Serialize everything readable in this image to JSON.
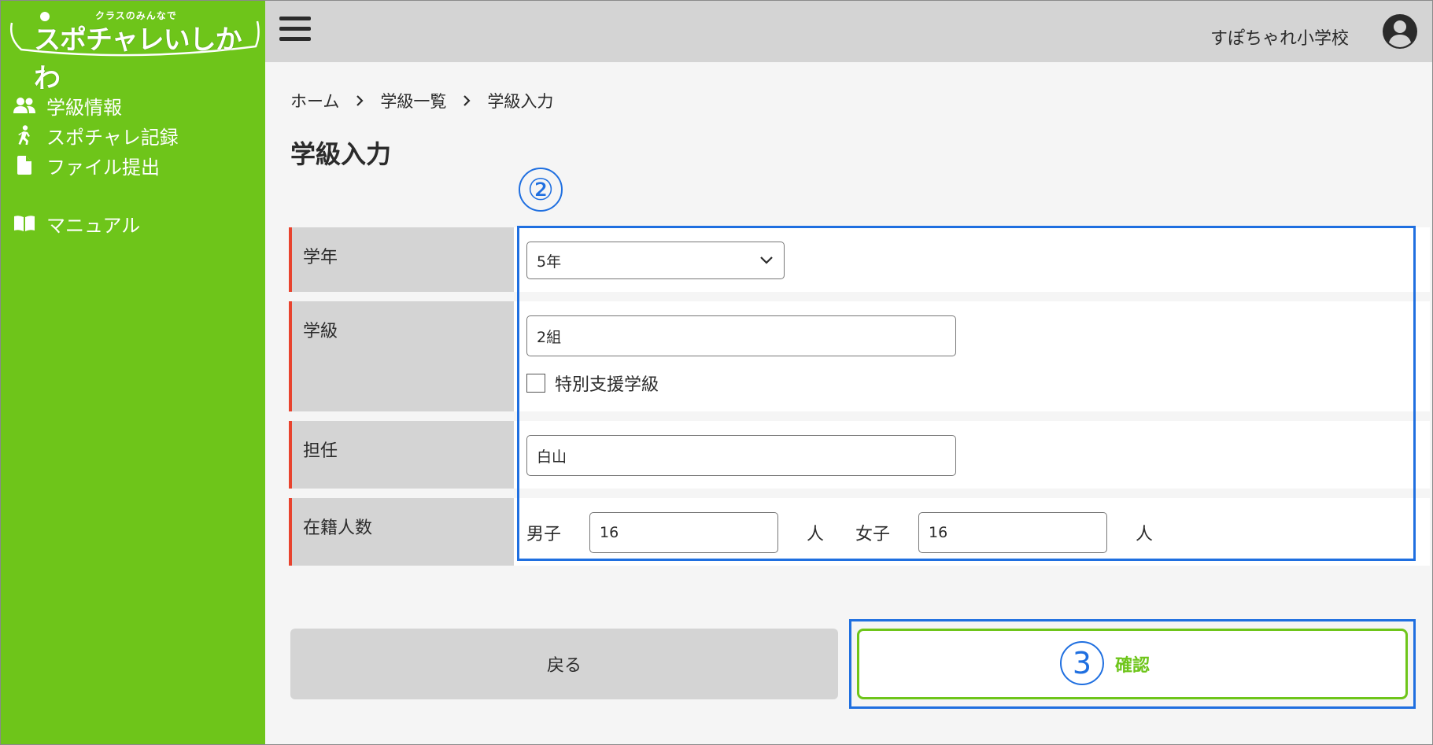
{
  "app": {
    "logo_sub": "クラスのみんなで",
    "logo_main": "スポチャレいしかわ"
  },
  "sidebar": {
    "items": [
      {
        "label": "学級情報",
        "icon": "people-icon"
      },
      {
        "label": "スポチャレ記録",
        "icon": "running-icon"
      },
      {
        "label": "ファイル提出",
        "icon": "file-icon"
      },
      {
        "label": "マニュアル",
        "icon": "book-icon"
      }
    ]
  },
  "header": {
    "school_name": "すぽちゃれ小学校"
  },
  "breadcrumb": [
    "ホーム",
    "学級一覧",
    "学級入力"
  ],
  "page": {
    "title": "学級入力"
  },
  "form": {
    "grade": {
      "label": "学年",
      "value": "5年"
    },
    "class": {
      "label": "学級",
      "value": "2組",
      "checkbox_label": "特別支援学級",
      "checked": false
    },
    "teacher": {
      "label": "担任",
      "value": "白山"
    },
    "enrollment": {
      "label": "在籍人数",
      "boys_label": "男子",
      "boys_value": "16",
      "boys_unit": "人",
      "girls_label": "女子",
      "girls_value": "16",
      "girls_unit": "人"
    }
  },
  "buttons": {
    "back": "戻る",
    "confirm": "確認"
  },
  "annotations": {
    "step2": "②",
    "step3": "3"
  },
  "colors": {
    "sidebar": "#6ec51a",
    "header": "#d4d4d4",
    "accent_red": "#e8432e",
    "annotation_blue": "#1f6fe0"
  }
}
